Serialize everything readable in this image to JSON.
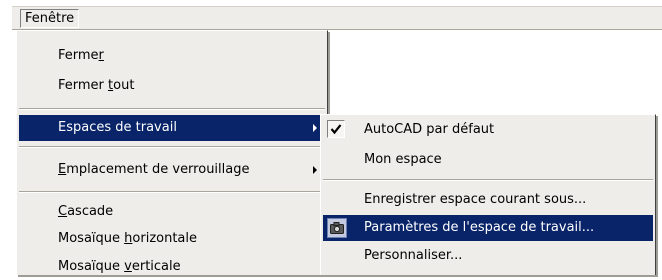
{
  "menubar": {
    "fenetre_label": "Fenêtre"
  },
  "main_menu": {
    "fermer": {
      "before": "Ferme",
      "mnemonic": "r",
      "after": ""
    },
    "fermer_tout": {
      "before": "Fermer ",
      "mnemonic": "t",
      "after": "out"
    },
    "espaces_de_travail": "Espaces de travail",
    "emplacement": {
      "before": "",
      "mnemonic": "E",
      "after": "mplacement de verrouillage"
    },
    "cascade": {
      "before": "",
      "mnemonic": "C",
      "after": "ascade"
    },
    "mosaique_horizontale": {
      "before": "Mosaïque ",
      "mnemonic": "h",
      "after": "orizontale"
    },
    "mosaique_verticale": {
      "before": "Mosaïque ",
      "mnemonic": "v",
      "after": "erticale"
    }
  },
  "submenu": {
    "autocad_defaut": "AutoCAD par défaut",
    "mon_espace": "Mon espace",
    "enregistrer": "Enregistrer espace courant sous...",
    "parametres": "Paramètres de l'espace de travail...",
    "personnaliser": "Personnaliser..."
  },
  "colors": {
    "highlight": "#0a246a",
    "menu_bg": "#eeedea"
  },
  "icons": {
    "check": "checkmark-icon",
    "workspace_settings": "camera-icon",
    "submenu": "submenu-arrow-icon"
  }
}
